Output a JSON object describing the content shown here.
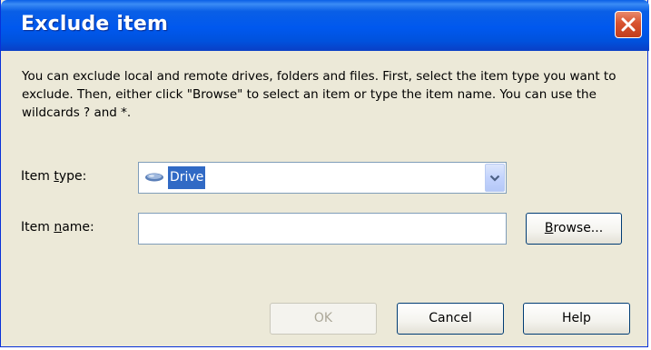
{
  "window": {
    "title": "Exclude item",
    "close_icon": "close-icon"
  },
  "description": "You can exclude local and remote drives, folders and files. First, select the item type you want to exclude. Then, either click \"Browse\" to select an item or type the item name. You can use the wildcards ? and *.",
  "item_type": {
    "label_pre": "Item ",
    "label_mnemonic": "t",
    "label_post": "ype:",
    "selected": "Drive",
    "icon": "drive-icon"
  },
  "item_name": {
    "label_pre": "Item ",
    "label_mnemonic": "n",
    "label_post": "ame:",
    "value": "",
    "placeholder": ""
  },
  "buttons": {
    "browse_mnemonic": "B",
    "browse_rest": "rowse...",
    "ok": "OK",
    "cancel": "Cancel",
    "help": "Help"
  },
  "colors": {
    "titlebar": "#0058ee",
    "selection": "#316ac5",
    "close": "#d8522f",
    "face": "#ece9d8"
  }
}
